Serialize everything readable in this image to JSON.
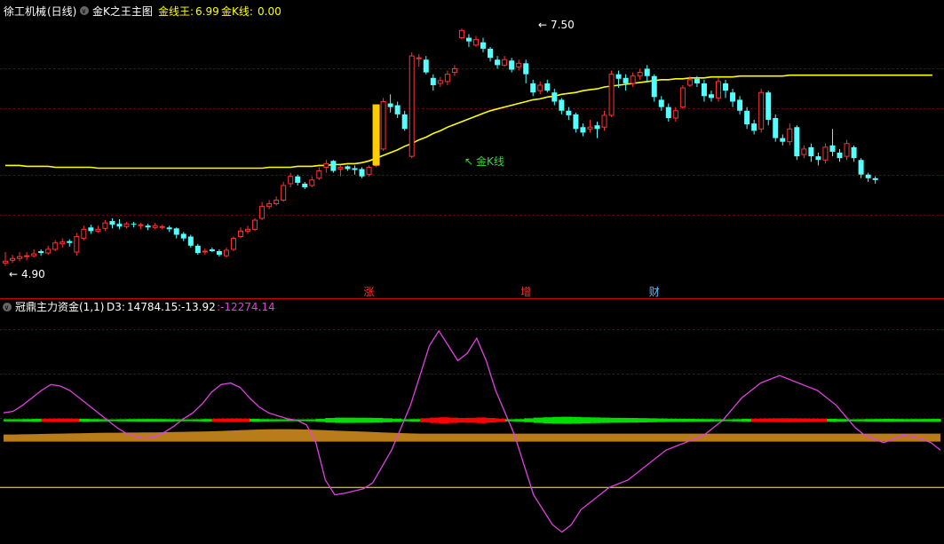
{
  "main_panel": {
    "stock_name": "徐工机械",
    "period": "(日线)",
    "indicator_name": "金K之王主图",
    "line_a_label": "金线王:",
    "line_a_value": "6.99",
    "line_b_label": "金K线:",
    "line_b_value": "0.00",
    "high_annotation": "7.50",
    "low_annotation": "4.90",
    "goldk_annotation": "金K线",
    "arrow_left": "←",
    "arrow_upleft": "↖"
  },
  "sub_panel": {
    "indicator_name": "冠鼎主力资金(1,1)",
    "d3_label": "D3:",
    "d3_value": "14784.15",
    "v2_value": ":-13.92",
    "v3_value": ":-12274.14"
  },
  "markers": [
    {
      "text": "涨",
      "bar": 51,
      "color": "#ff3333"
    },
    {
      "text": "增",
      "bar": 73,
      "color": "#ff3333"
    },
    {
      "text": "财",
      "bar": 91,
      "color": "#5fbfff"
    }
  ],
  "colors": {
    "up": "#ff3232",
    "down": "#54ffff",
    "gold_line": "#ffff00",
    "gold_bar": "#ffcc00",
    "purple": "#e040e0",
    "orange": "#cc8a1e",
    "grey": "#c8c8c8",
    "green": "#00dd00",
    "red": "#ff0000",
    "grid": "#7a0000",
    "divider": "#cc0000",
    "text_white": "#ffffff",
    "text_yellow": "#ffff00",
    "text_green": "#33dd33"
  },
  "chart_data": [
    {
      "type": "candlestick",
      "price_range": [
        4.7,
        7.6
      ],
      "candles": [
        [
          4.93,
          4.95,
          5.05,
          4.9
        ],
        [
          4.96,
          4.98,
          5.02,
          4.93
        ],
        [
          4.98,
          5.0,
          5.05,
          4.95
        ],
        [
          5.0,
          5.01,
          5.05,
          4.96
        ],
        [
          5.01,
          5.03,
          5.08,
          4.99
        ],
        [
          5.06,
          5.04,
          5.08,
          5.01
        ],
        [
          5.04,
          5.08,
          5.12,
          5.02
        ],
        [
          5.08,
          5.15,
          5.18,
          5.06
        ],
        [
          5.14,
          5.16,
          5.2,
          5.1
        ],
        [
          5.17,
          5.15,
          5.19,
          5.11
        ],
        [
          5.05,
          5.22,
          5.26,
          5.01
        ],
        [
          5.2,
          5.3,
          5.34,
          5.18
        ],
        [
          5.32,
          5.28,
          5.35,
          5.25
        ],
        [
          5.28,
          5.3,
          5.34,
          5.26
        ],
        [
          5.31,
          5.37,
          5.4,
          5.28
        ],
        [
          5.39,
          5.35,
          5.42,
          5.31
        ],
        [
          5.36,
          5.33,
          5.41,
          5.3
        ],
        [
          5.33,
          5.36,
          5.38,
          5.31
        ],
        [
          5.36,
          5.35,
          5.38,
          5.32
        ],
        [
          5.34,
          5.35,
          5.37,
          5.3
        ],
        [
          5.34,
          5.32,
          5.36,
          5.29
        ],
        [
          5.32,
          5.34,
          5.37,
          5.3
        ],
        [
          5.33,
          5.33,
          5.35,
          5.3
        ],
        [
          5.32,
          5.3,
          5.34,
          5.27
        ],
        [
          5.31,
          5.24,
          5.32,
          5.2
        ],
        [
          5.25,
          5.2,
          5.27,
          5.17
        ],
        [
          5.22,
          5.12,
          5.24,
          5.1
        ],
        [
          5.12,
          5.04,
          5.14,
          5.02
        ],
        [
          5.05,
          5.06,
          5.09,
          5.02
        ],
        [
          5.08,
          5.06,
          5.1,
          5.05
        ],
        [
          5.06,
          5.02,
          5.08,
          5.0
        ],
        [
          5.01,
          5.07,
          5.1,
          4.99
        ],
        [
          5.08,
          5.2,
          5.22,
          5.06
        ],
        [
          5.22,
          5.28,
          5.32,
          5.2
        ],
        [
          5.28,
          5.3,
          5.34,
          5.25
        ],
        [
          5.3,
          5.4,
          5.42,
          5.28
        ],
        [
          5.42,
          5.55,
          5.6,
          5.4
        ],
        [
          5.55,
          5.58,
          5.62,
          5.52
        ],
        [
          5.58,
          5.62,
          5.66,
          5.56
        ],
        [
          5.62,
          5.78,
          5.82,
          5.6
        ],
        [
          5.8,
          5.88,
          5.92,
          5.76
        ],
        [
          5.88,
          5.81,
          5.9,
          5.78
        ],
        [
          5.8,
          5.76,
          5.82,
          5.74
        ],
        [
          5.78,
          5.84,
          5.88,
          5.76
        ],
        [
          5.86,
          5.94,
          5.98,
          5.84
        ],
        [
          5.98,
          6.02,
          6.06,
          5.92
        ],
        [
          6.05,
          5.94,
          6.06,
          5.92
        ],
        [
          5.96,
          5.98,
          6.0,
          5.88
        ],
        [
          5.99,
          5.96,
          6.0,
          5.94
        ],
        [
          5.97,
          5.95,
          6.0,
          5.9
        ],
        [
          5.96,
          5.88,
          5.98,
          5.86
        ],
        [
          5.9,
          5.98,
          6.0,
          5.88
        ],
        [
          6.0,
          6.18,
          6.22,
          5.98
        ],
        [
          6.18,
          6.7,
          6.74,
          6.16
        ],
        [
          6.68,
          6.64,
          6.78,
          6.58
        ],
        [
          6.66,
          6.56,
          6.7,
          6.52
        ],
        [
          6.56,
          6.4,
          6.6,
          6.38
        ],
        [
          6.1,
          7.2,
          7.24,
          6.08
        ],
        [
          7.18,
          7.18,
          7.22,
          7.08
        ],
        [
          7.16,
          7.02,
          7.2,
          7.0
        ],
        [
          6.96,
          6.88,
          7.0,
          6.82
        ],
        [
          6.9,
          6.93,
          6.97,
          6.86
        ],
        [
          6.92,
          7.0,
          7.04,
          6.88
        ],
        [
          7.02,
          7.06,
          7.1,
          6.98
        ],
        [
          7.4,
          7.48,
          7.5,
          7.38
        ],
        [
          7.4,
          7.36,
          7.44,
          7.3
        ],
        [
          7.32,
          7.38,
          7.42,
          7.3
        ],
        [
          7.35,
          7.28,
          7.4,
          7.24
        ],
        [
          7.28,
          7.18,
          7.3,
          7.14
        ],
        [
          7.16,
          7.1,
          7.2,
          7.06
        ],
        [
          7.1,
          7.16,
          7.2,
          7.08
        ],
        [
          7.15,
          7.05,
          7.18,
          7.02
        ],
        [
          7.08,
          7.12,
          7.16,
          7.04
        ],
        [
          7.12,
          7.0,
          7.16,
          6.9
        ],
        [
          6.9,
          6.8,
          6.94,
          6.76
        ],
        [
          6.82,
          6.88,
          6.92,
          6.78
        ],
        [
          6.9,
          6.82,
          6.94,
          6.8
        ],
        [
          6.8,
          6.7,
          6.84,
          6.66
        ],
        [
          6.72,
          6.6,
          6.74,
          6.56
        ],
        [
          6.6,
          6.55,
          6.64,
          6.5
        ],
        [
          6.56,
          6.4,
          6.58,
          6.36
        ],
        [
          6.42,
          6.36,
          6.46,
          6.32
        ],
        [
          6.4,
          6.42,
          6.5,
          6.36
        ],
        [
          6.44,
          6.4,
          6.48,
          6.3
        ],
        [
          6.42,
          6.55,
          6.6,
          6.38
        ],
        [
          6.55,
          7.0,
          7.04,
          6.53
        ],
        [
          7.0,
          6.95,
          7.04,
          6.85
        ],
        [
          6.96,
          6.9,
          7.0,
          6.82
        ],
        [
          6.9,
          6.98,
          7.02,
          6.86
        ],
        [
          6.98,
          7.02,
          7.06,
          6.94
        ],
        [
          7.06,
          6.98,
          7.1,
          6.92
        ],
        [
          6.98,
          6.75,
          7.0,
          6.7
        ],
        [
          6.72,
          6.64,
          6.76,
          6.6
        ],
        [
          6.64,
          6.52,
          6.68,
          6.48
        ],
        [
          6.52,
          6.6,
          6.64,
          6.48
        ],
        [
          6.64,
          6.85,
          6.88,
          6.62
        ],
        [
          6.88,
          6.94,
          6.98,
          6.86
        ],
        [
          6.95,
          6.9,
          6.98,
          6.86
        ],
        [
          6.9,
          6.76,
          6.94,
          6.7
        ],
        [
          6.78,
          6.74,
          6.82,
          6.7
        ],
        [
          6.74,
          6.92,
          6.96,
          6.7
        ],
        [
          6.9,
          6.82,
          6.94,
          6.74
        ],
        [
          6.8,
          6.7,
          6.84,
          6.64
        ],
        [
          6.72,
          6.6,
          6.76,
          6.56
        ],
        [
          6.6,
          6.45,
          6.64,
          6.4
        ],
        [
          6.46,
          6.38,
          6.5,
          6.34
        ],
        [
          6.4,
          6.8,
          6.84,
          6.36
        ],
        [
          6.8,
          6.5,
          6.82,
          6.44
        ],
        [
          6.52,
          6.3,
          6.56,
          6.26
        ],
        [
          6.3,
          6.26,
          6.34,
          6.22
        ],
        [
          6.26,
          6.4,
          6.46,
          6.22
        ],
        [
          6.42,
          6.1,
          6.44,
          6.06
        ],
        [
          6.12,
          6.18,
          6.22,
          6.08
        ],
        [
          6.2,
          6.1,
          6.24,
          6.04
        ],
        [
          6.1,
          6.06,
          6.14,
          6.0
        ],
        [
          6.06,
          6.2,
          6.24,
          6.02
        ],
        [
          6.22,
          6.15,
          6.4,
          6.1
        ],
        [
          6.14,
          6.08,
          6.18,
          6.04
        ],
        [
          6.1,
          6.24,
          6.28,
          6.06
        ],
        [
          6.2,
          6.08,
          6.22,
          6.04
        ],
        [
          6.06,
          5.9,
          6.08,
          5.86
        ],
        [
          5.9,
          5.86,
          5.92,
          5.82
        ],
        [
          5.86,
          5.84,
          5.88,
          5.8
        ]
      ],
      "gold_king_line": [
        6.0,
        6.0,
        6.0,
        5.99,
        5.99,
        5.99,
        5.99,
        5.98,
        5.98,
        5.98,
        5.98,
        5.98,
        5.98,
        5.97,
        5.97,
        5.97,
        5.97,
        5.97,
        5.97,
        5.97,
        5.97,
        5.97,
        5.97,
        5.97,
        5.97,
        5.97,
        5.97,
        5.97,
        5.97,
        5.97,
        5.97,
        5.97,
        5.97,
        5.97,
        5.97,
        5.97,
        5.97,
        5.98,
        5.98,
        5.98,
        5.98,
        5.99,
        5.99,
        5.99,
        6.0,
        6.0,
        6.01,
        6.01,
        6.02,
        6.02,
        6.03,
        6.05,
        6.08,
        6.11,
        6.14,
        6.17,
        6.21,
        6.24,
        6.28,
        6.31,
        6.35,
        6.38,
        6.42,
        6.45,
        6.48,
        6.51,
        6.54,
        6.57,
        6.6,
        6.62,
        6.64,
        6.66,
        6.68,
        6.7,
        6.72,
        6.73,
        6.75,
        6.76,
        6.78,
        6.79,
        6.8,
        6.82,
        6.83,
        6.84,
        6.86,
        6.87,
        6.88,
        6.89,
        6.9,
        6.91,
        6.92,
        6.93,
        6.94,
        6.94,
        6.95,
        6.95,
        6.96,
        6.96,
        6.96,
        6.97,
        6.97,
        6.97,
        6.97,
        6.98,
        6.98,
        6.98,
        6.98,
        6.98,
        6.98,
        6.98,
        6.99,
        6.99,
        6.99,
        6.99,
        6.99,
        6.99,
        6.99,
        6.99,
        6.99,
        6.99,
        6.99,
        6.99,
        6.99,
        6.99,
        6.99,
        6.99,
        6.99,
        6.99,
        6.99,
        6.99,
        6.99
      ],
      "gold_k_bar": {
        "bar": 52,
        "low": 6.0,
        "high": 6.67
      }
    },
    {
      "type": "line",
      "value_range": [
        -1,
        1
      ],
      "series": [
        {
          "values": [
            0.1,
            0.12,
            0.2,
            0.3,
            0.4,
            0.48,
            0.46,
            0.4,
            0.3,
            0.2,
            0.1,
            0.0,
            -0.1,
            -0.18,
            -0.22,
            -0.24,
            -0.22,
            -0.16,
            -0.08,
            0.02,
            0.1,
            0.22,
            0.38,
            0.48,
            0.5,
            0.44,
            0.3,
            0.18,
            0.1,
            0.06,
            0.02,
            0.0,
            -0.06,
            -0.3,
            -0.8,
            -1.0,
            -0.98,
            -0.95,
            -0.92,
            -0.84,
            -0.62,
            -0.4,
            -0.1,
            0.2,
            0.6,
            1.0,
            1.2,
            1.0,
            0.8,
            0.9,
            1.1,
            0.8,
            0.4,
            0.1,
            -0.2,
            -0.6,
            -1.0,
            -1.2,
            -1.4,
            -1.5,
            -1.4,
            -1.2,
            -1.1,
            -1.0,
            -0.9,
            -0.85,
            -0.8,
            -0.7,
            -0.6,
            -0.5,
            -0.4,
            -0.35,
            -0.3,
            -0.25,
            -0.2,
            -0.1,
            0.0,
            0.15,
            0.3,
            0.4,
            0.5,
            0.55,
            0.6,
            0.55,
            0.5,
            0.45,
            0.4,
            0.3,
            0.2,
            0.05,
            -0.1,
            -0.2,
            -0.25,
            -0.3,
            -0.25,
            -0.2,
            -0.22,
            -0.25,
            -0.3,
            -0.4
          ]
        },
        {
          "values": [
            0.2,
            0.2,
            0.21,
            0.22,
            0.23,
            0.24,
            0.25,
            0.26,
            0.27,
            0.28,
            0.29,
            0.3,
            0.3,
            0.31,
            0.31,
            0.32,
            0.32,
            0.33,
            0.34,
            0.35,
            0.36,
            0.37,
            0.38,
            0.4,
            0.42,
            0.44,
            0.46,
            0.48,
            0.49,
            0.5,
            0.5,
            0.49,
            0.48,
            0.46,
            0.44,
            0.42,
            0.4,
            0.38,
            0.36,
            0.34,
            0.32,
            0.3,
            0.28,
            0.26,
            0.25,
            0.25,
            0.25,
            0.25,
            0.25,
            0.25,
            0.25,
            0.25,
            0.25,
            0.25,
            0.25,
            0.25,
            0.25,
            0.25,
            0.25,
            0.25,
            0.25,
            0.25,
            0.25,
            0.25,
            0.25,
            0.25,
            0.25,
            0.25,
            0.25,
            0.25,
            0.25,
            0.25,
            0.25,
            0.25,
            0.25,
            0.25,
            0.25,
            0.25,
            0.25,
            0.25,
            0.25,
            0.25,
            0.25,
            0.25,
            0.25,
            0.25,
            0.25,
            0.25,
            0.25,
            0.25,
            0.25,
            0.25,
            0.25,
            0.25,
            0.25,
            0.25,
            0.25,
            0.25,
            0.25,
            0.25
          ]
        },
        {
          "values": [
            0.0,
            0.0,
            0.0,
            0.0,
            0.0,
            0.0,
            0.0,
            0.0,
            0.0,
            0.0,
            0.0,
            0.0,
            0.0,
            0.0,
            0.0,
            0.0,
            0.0,
            0.0,
            0.0,
            0.0,
            0.0,
            0.0,
            0.0,
            0.0,
            0.0,
            0.0,
            0.0,
            0.0,
            0.0,
            0.0,
            0.0,
            0.0,
            0.0,
            0.0,
            0.0,
            0.0,
            0.0,
            0.0,
            0.0,
            0.0,
            0.0,
            0.0,
            0.0,
            0.0,
            0.0,
            0.0,
            0.0,
            0.0,
            0.0,
            0.0,
            0.0,
            0.0,
            0.0,
            0.0,
            0.0,
            0.0,
            0.0,
            0.0,
            0.0,
            0.0,
            0.0,
            0.0,
            0.0,
            0.0,
            0.0,
            0.0,
            0.0,
            0.0,
            0.0,
            0.0,
            0.0,
            0.0,
            0.0,
            0.0,
            0.0,
            0.0,
            0.0,
            0.0,
            0.0,
            0.0,
            0.0,
            0.0,
            0.0,
            0.0,
            0.0,
            0.0,
            0.0,
            0.0,
            0.0,
            0.0,
            0.0,
            0.0,
            0.0,
            0.0,
            0.0,
            0.0,
            0.0,
            0.0,
            0.0,
            0.0
          ]
        }
      ]
    }
  ]
}
